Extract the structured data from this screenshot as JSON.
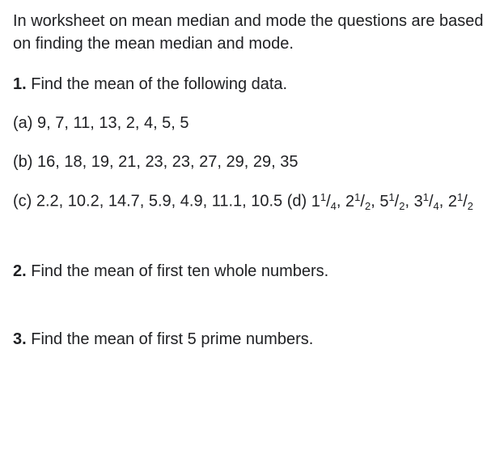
{
  "intro": "In worksheet on mean median and mode the questions are based on finding the mean median and mode.",
  "q1": {
    "num": "1.",
    "text": "Find the mean of the following data.",
    "a": "(a) 9, 7, 11, 13, 2, 4, 5, 5",
    "b": "(b) 16, 18, 19, 21, 23, 23, 27, 29, 29, 35",
    "c_prefix": "(c) 2.2, 10.2, 14.7, 5.9, 4.9, 11.1, 10.5 (d) ",
    "fractions": [
      {
        "whole": "1",
        "num": "1",
        "den": "4"
      },
      {
        "whole": "2",
        "num": "1",
        "den": "2"
      },
      {
        "whole": "5",
        "num": "1",
        "den": "2"
      },
      {
        "whole": "3",
        "num": "1",
        "den": "4"
      },
      {
        "whole": "2",
        "num": "1",
        "den": "2"
      }
    ],
    "comma": ", "
  },
  "q2": {
    "num": "2.",
    "text": "Find the mean of first ten whole numbers."
  },
  "q3": {
    "num": "3.",
    "text": "Find the mean of first 5 prime numbers."
  }
}
